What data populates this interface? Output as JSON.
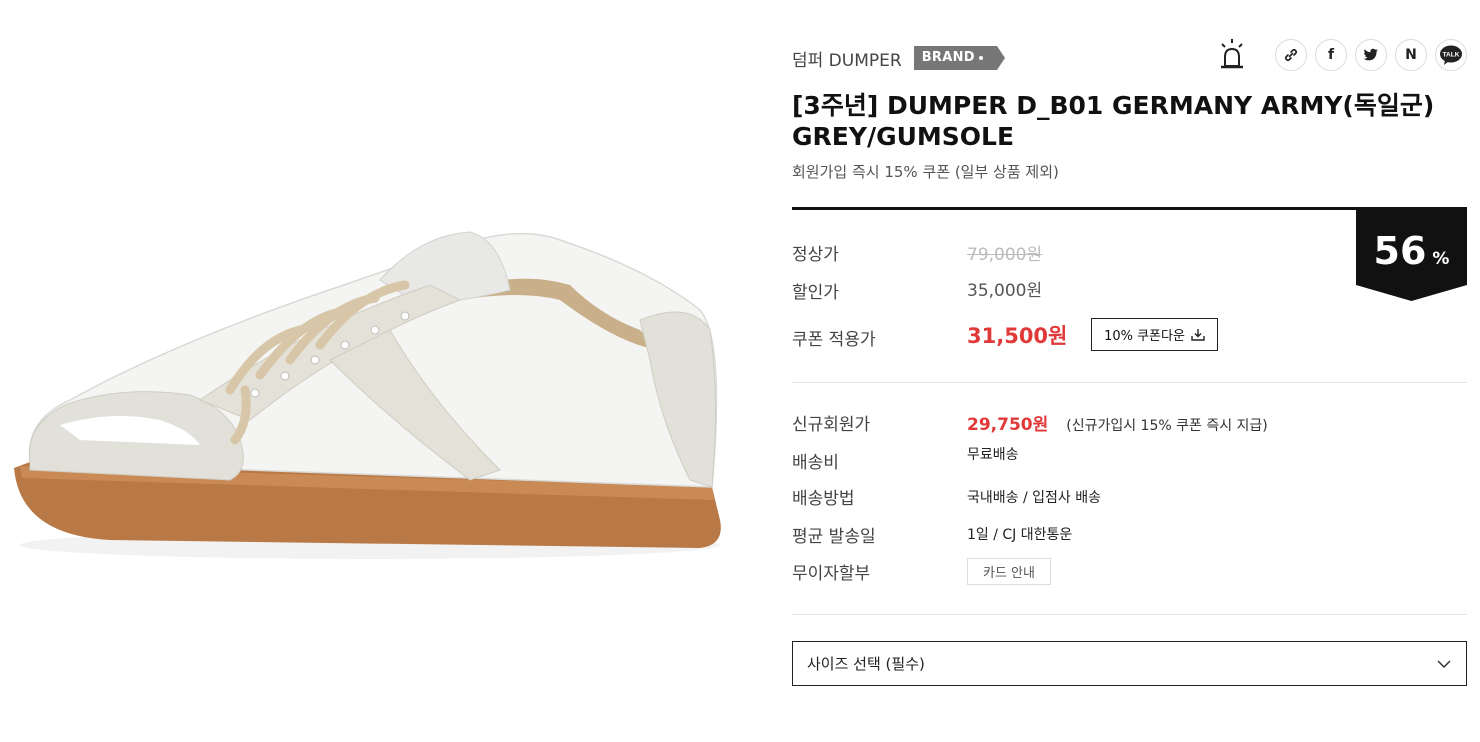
{
  "brand": {
    "name": "덤퍼 DUMPER",
    "badge": "BRAND"
  },
  "share": {
    "icons": [
      "alarm-icon",
      "link-icon",
      "facebook-icon",
      "twitter-icon",
      "naver-icon",
      "kakaotalk-icon"
    ],
    "facebook_label": "f",
    "naver_label": "N",
    "talk_label": "TALK"
  },
  "product": {
    "title": "[3주년] DUMPER D_B01 GERMANY ARMY(독일군) GREY/GUMSOLE",
    "subtitle": "회원가입 즉시 15% 쿠폰 (일부 상품 제외)"
  },
  "discount": {
    "rate": "56",
    "unit": "%"
  },
  "prices": {
    "regular_label": "정상가",
    "regular_value": "79,000원",
    "sale_label": "할인가",
    "sale_value": "35,000원",
    "coupon_label": "쿠폰 적용가",
    "coupon_value": "31,500원",
    "coupon_button": "10% 쿠폰다운"
  },
  "details": {
    "member_label": "신규회원가",
    "member_value": "29,750원",
    "member_note": "(신규가입시 15% 쿠폰 즉시 지급)",
    "shipping_fee_label": "배송비",
    "shipping_fee_value": "무료배송",
    "shipping_method_label": "배송방법",
    "shipping_method_value": "국내배송 / 입점사 배송",
    "avg_ship_label": "평균 발송일",
    "avg_ship_value": "1일 / CJ 대한통운",
    "installment_label": "무이자할부",
    "card_button": "카드 안내"
  },
  "size_select": {
    "placeholder": "사이즈 선택 (필수)"
  },
  "colors": {
    "accent_red": "#e13939",
    "badge_gray": "#777777",
    "discount_black": "#111111"
  }
}
